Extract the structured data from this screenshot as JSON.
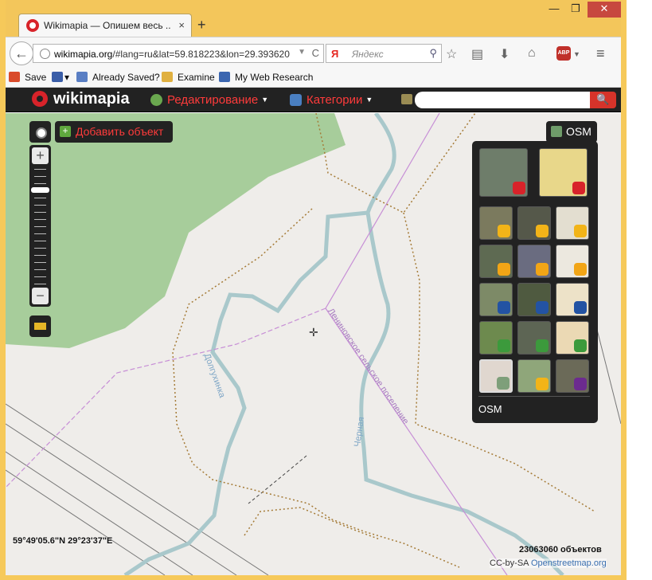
{
  "browser": {
    "tab_title": "Wikimapia — Опишем весь ...",
    "tab_close": "×",
    "new_tab": "+",
    "window": {
      "minimize": "—",
      "maximize": "❐",
      "close": "✕"
    },
    "url_prefix": "wikimapia.org",
    "url_rest": "/#lang=ru&lat=59.818223&lon=29.393620",
    "search_engine": "Я",
    "search_placeholder": "Яндекс",
    "back": "←",
    "reload": "C",
    "menu": "≡",
    "abp": "ABP"
  },
  "bookmarks": {
    "items": [
      {
        "label": "Save",
        "icon_color": "#d94b2b"
      },
      {
        "label": "Already Saved?",
        "icon_color": "#5a7fc4"
      },
      {
        "label": "Examine",
        "icon_color": "#e0b040"
      },
      {
        "label": "My Web Research",
        "icon_color": "#3b66b0"
      }
    ]
  },
  "wikimapia": {
    "brand": "wikimapia",
    "menu_edit": "Редактирование",
    "menu_categories": "Категории",
    "search_button": "🔍"
  },
  "map": {
    "add_object": "Добавить объект",
    "layer_button": "OSM",
    "layer_caption": "OSM",
    "labels": {
      "river1": "Долгухинка",
      "river2": "Черная",
      "boundary": "Лениновское сельское поселение"
    },
    "coordinates": "59°49'05.6\"N 29°23'37\"E",
    "object_count": "23063060 объектов",
    "credit_prefix": "CC-by-SA",
    "credit_link": "Openstreetmap.org"
  },
  "colors": {
    "accent_red": "#d8232a",
    "menu_red": "#ff3b3b",
    "water": "#a9c8cb",
    "forest": "#a7cd9b",
    "boundary": "#c78fd6",
    "path": "#a57b37"
  }
}
